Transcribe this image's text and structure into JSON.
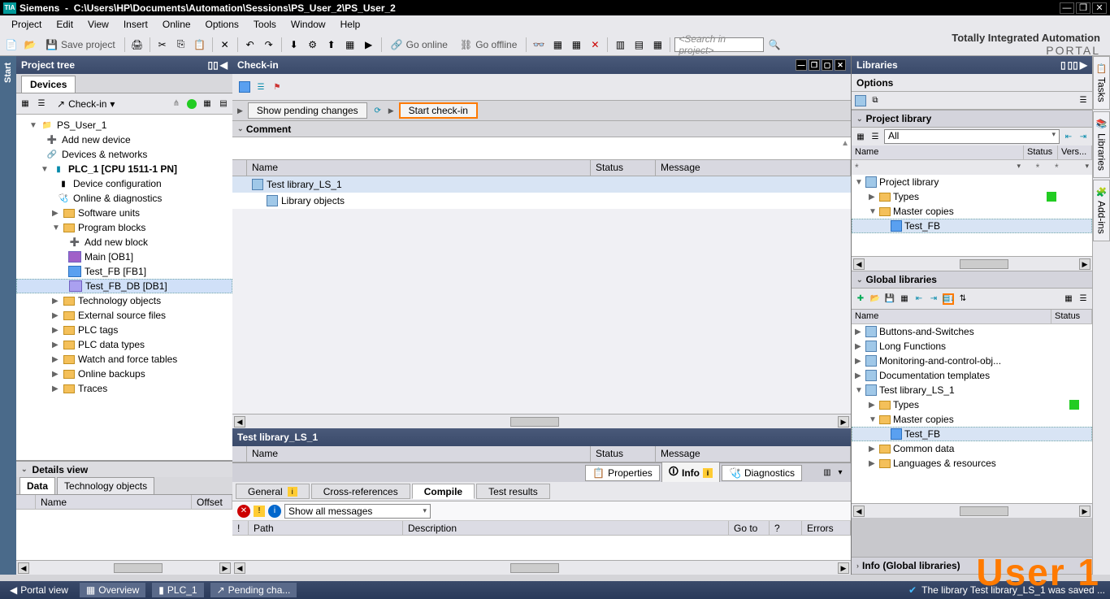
{
  "titlebar": {
    "app": "Siemens",
    "path": "C:\\Users\\HP\\Documents\\Automation\\Sessions\\PS_User_2\\PS_User_2"
  },
  "menu": [
    "Project",
    "Edit",
    "View",
    "Insert",
    "Online",
    "Options",
    "Tools",
    "Window",
    "Help"
  ],
  "toolbar": {
    "save": "Save project",
    "go_online": "Go online",
    "go_offline": "Go offline",
    "search_placeholder": "<Search in project>"
  },
  "brand": {
    "line1": "Totally Integrated Automation",
    "line2": "PORTAL"
  },
  "left": {
    "title": "Project tree",
    "devices_tab": "Devices",
    "checkin_btn": "Check-in",
    "tree": {
      "root": "PS_User_1",
      "items": [
        "Add new device",
        "Devices & networks"
      ],
      "plc": "PLC_1 [CPU 1511-1 PN]",
      "plc_children": [
        "Device configuration",
        "Online & diagnostics",
        "Software units",
        "Program blocks"
      ],
      "blocks": [
        "Add new block",
        "Main [OB1]",
        "Test_FB [FB1]",
        "Test_FB_DB [DB1]"
      ],
      "more": [
        "Technology objects",
        "External source files",
        "PLC tags",
        "PLC data types",
        "Watch and force tables",
        "Online backups",
        "Traces"
      ]
    },
    "details": {
      "title": "Details view",
      "tabs": [
        "Data",
        "Technology objects"
      ],
      "cols": [
        "Name",
        "Offset"
      ]
    }
  },
  "center": {
    "title": "Check-in",
    "show_pending": "Show pending changes",
    "start_checkin": "Start check-in",
    "comment_label": "Comment",
    "grid_cols": [
      "Name",
      "Status",
      "Message"
    ],
    "rows": [
      {
        "name": "Test library_LS_1"
      },
      {
        "name": "Library objects"
      }
    ],
    "sub_title": "Test library_LS_1",
    "inspector_tabs": [
      "Properties",
      "Info",
      "Diagnostics"
    ],
    "subtabs": [
      "General",
      "Cross-references",
      "Compile",
      "Test results"
    ],
    "msg_filter": "Show all messages",
    "msg_cols": [
      "!",
      "Path",
      "Description",
      "Go to",
      "?",
      "Errors"
    ]
  },
  "right": {
    "title": "Libraries",
    "options": "Options",
    "project_lib": "Project library",
    "filter_all": "All",
    "lib_cols": [
      "Name",
      "Status",
      "Vers..."
    ],
    "plib_tree": {
      "root": "Project library",
      "types": "Types",
      "master": "Master copies",
      "fb": "Test_FB"
    },
    "global_lib": "Global libraries",
    "glib_rows": [
      "Buttons-and-Switches",
      "Long Functions",
      "Monitoring-and-control-obj...",
      "Documentation templates"
    ],
    "test_lib": "Test library_LS_1",
    "test_children": {
      "types": "Types",
      "master": "Master copies",
      "fb": "Test_FB",
      "common": "Common data",
      "lang": "Languages & resources"
    },
    "info_bar": "Info (Global libraries)",
    "vtabs": [
      "Tasks",
      "Libraries",
      "Add-ins"
    ]
  },
  "status": {
    "portal": "Portal view",
    "overview": "Overview",
    "plc": "PLC_1",
    "pending": "Pending cha...",
    "saved_msg": "The library Test library_LS_1 was saved ..."
  },
  "watermark": "User 1"
}
